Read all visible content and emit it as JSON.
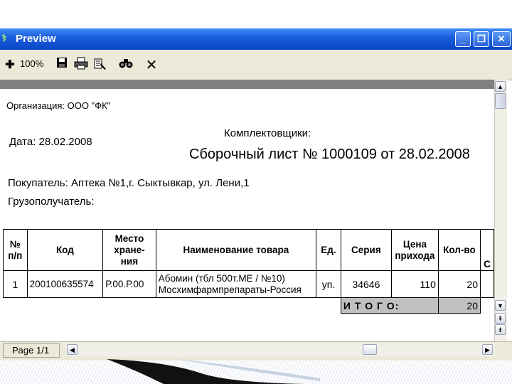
{
  "window": {
    "title": "Preview",
    "controls": {
      "minimize": "_",
      "restore": "❐",
      "close": "✕"
    }
  },
  "toolbar": {
    "zoom_label": "100%",
    "icons": [
      "zoom-icon",
      "save-icon",
      "print-icon",
      "print-setup-icon",
      "find-icon",
      "close-icon"
    ]
  },
  "document": {
    "organization": "Организация: ООО \"ФК\"",
    "date": "Дата: 28.02.2008",
    "pickers": "Комплектовщики:",
    "heading": "Сборочный лист № 1000109 от 28.02.2008",
    "buyer": "Покупатель: Аптека №1,г. Сыктывкар, ул. Лени,1",
    "consignee": "Грузополучатель:"
  },
  "table": {
    "headers": {
      "num": "№ п/п",
      "code": "Код",
      "location": "Место хране-ния",
      "name": "Наименование товара",
      "unit": "Ед.",
      "series": "Серия",
      "price": "Цена прихода",
      "qty": "Кол-во",
      "next": "С"
    },
    "rows": [
      {
        "num": "1",
        "code": "200100635574",
        "location": "Р.00.Р.00",
        "name_line1": "Абомин (тбл 500т.МЕ / №10)",
        "name_line2": "Мосхимфармпрепараты-Россия",
        "unit": "уп.",
        "series": "34646",
        "price": "110",
        "qty": "20"
      }
    ],
    "total_label": "И Т О Г О:",
    "total_qty": "20"
  },
  "status": {
    "page": "Page 1/1"
  }
}
